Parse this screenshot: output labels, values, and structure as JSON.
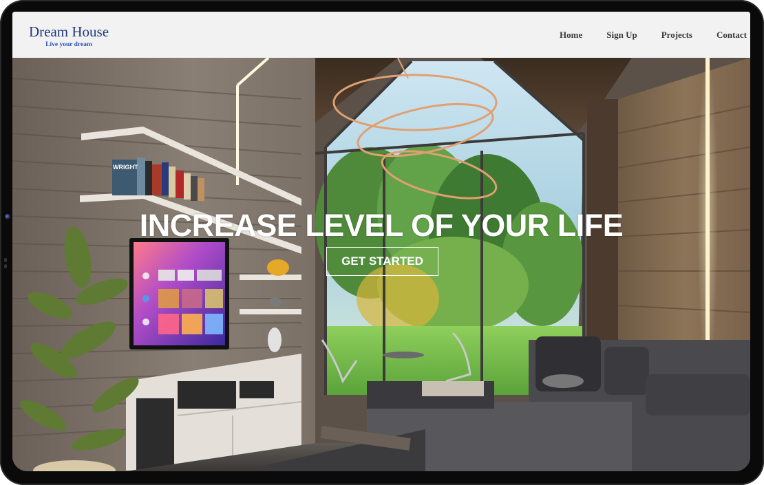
{
  "brand": {
    "title": "Dream House",
    "tagline": "Live your dream"
  },
  "nav": {
    "items": [
      {
        "label": "Home"
      },
      {
        "label": "Sign Up"
      },
      {
        "label": "Projects"
      },
      {
        "label": "Contact"
      }
    ]
  },
  "hero": {
    "headline": "INCREASE LEVEL OF YOUR LIFE",
    "cta_label": "GET STARTED",
    "book_spine_text": "WRIGHT"
  },
  "colors": {
    "brand": "#1f3a7a",
    "tagline": "#2a52b8",
    "navbar_bg": "#f2f2f3",
    "nav_text": "#3a3a3a",
    "hero_text": "#ffffff",
    "device_frame": "#0a0a0a"
  }
}
